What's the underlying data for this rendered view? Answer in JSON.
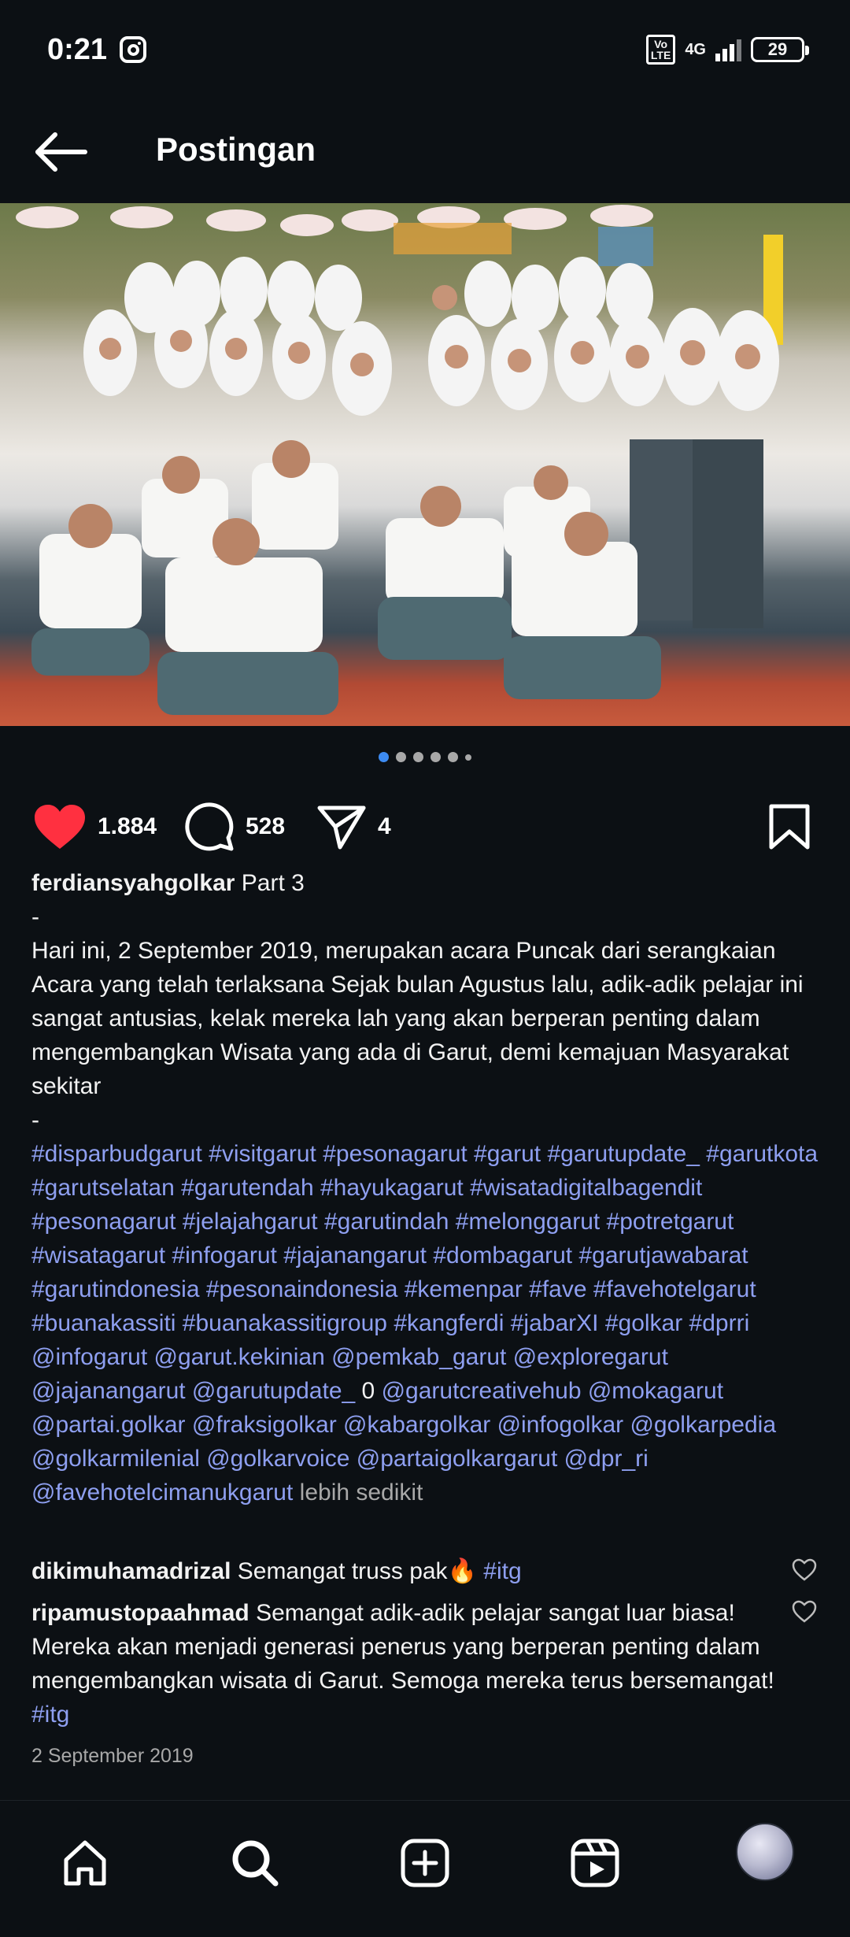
{
  "status": {
    "time": "0:21",
    "volte": "Vo LTE",
    "network": "4G",
    "battery": "29"
  },
  "header": {
    "title": "Postingan"
  },
  "carousel": {
    "total": 6,
    "active_index": 0
  },
  "actions": {
    "likes": "1.884",
    "comments": "528",
    "shares": "4"
  },
  "caption": {
    "username": "ferdiansyahgolkar",
    "title": "Part 3",
    "sep1": "-",
    "body": "Hari ini, 2 September 2019, merupakan acara Puncak dari serangkaian Acara yang telah terlaksana Sejak bulan Agustus lalu, adik-adik pelajar ini sangat antusias, kelak mereka lah yang akan berperan penting dalam mengembangkan Wisata yang ada di Garut, demi kemajuan Masyarakat sekitar",
    "sep2": "-",
    "hashtags": "#disparbudgarut #visitgarut #pesonagarut #garut #garutupdate_ #garutkota #garutselatan #garutendah #hayukagarut #wisatadigitalbagendit #pesonagarut #jelajahgarut #garutindah #melonggarut #potretgarut #wisatagarut #infogarut #jajanangarut #dombagarut #garutjawabarat #garutindonesia #pesonaindonesia #kemenpar #fave #favehotelgarut #buanakassiti #buanakassitigroup #kangferdi #jabarXI #golkar #dprri",
    "mentions_1": "@infogarut @garut.kekinian @pemkab_garut @exploregarut @jajanangarut @garutupdate_",
    "zero": "0",
    "mentions_2": "@garutcreativehub @mokagarut @partai.golkar @fraksigolkar @kabargolkar @infogolkar @golkarpedia @golkarmilenial @golkarvoice @partaigolkargarut @dpr_ri @favehotelcimanukgarut",
    "more": "lebih sedikit"
  },
  "comments": [
    {
      "username": "dikimuhamadrizal",
      "text": "Semangat truss pak🔥",
      "tag": "#itg"
    },
    {
      "username": "ripamustopaahmad",
      "text": "Semangat adik-adik pelajar sangat luar biasa! Mereka akan menjadi generasi penerus yang berperan penting dalam mengembangkan wisata di Garut. Semoga mereka terus bersemangat!",
      "tag": "#itg"
    }
  ],
  "date": "2 September 2019",
  "colors": {
    "background": "#0c1014",
    "like_red": "#ff3040",
    "hashtag": "#8e9ff0",
    "muted": "#a8a8a8",
    "active_dot": "#3d8bf2"
  }
}
